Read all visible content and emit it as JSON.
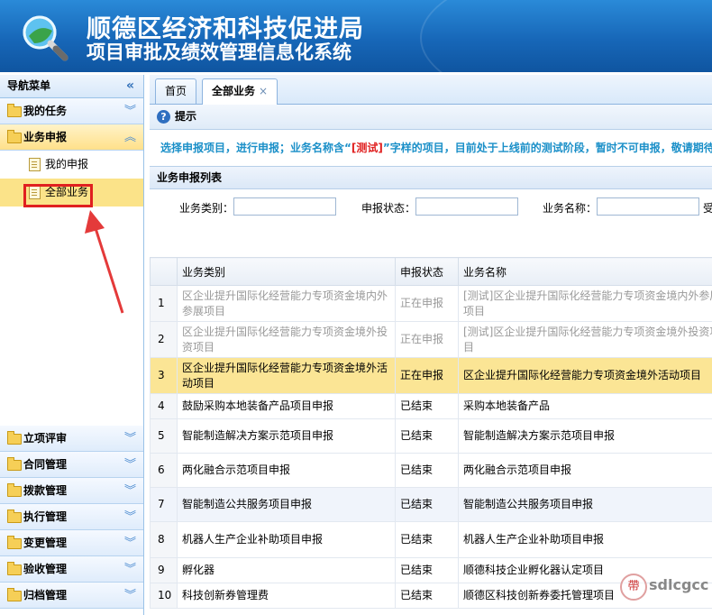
{
  "header": {
    "title_line1": "顺德区经济和科技促进局",
    "title_line2": "项目审批及绩效管理信息化系统"
  },
  "sidebar": {
    "title": "导航菜单",
    "collapse_icon": "double-chevron-left",
    "menus_top": [
      {
        "label": "我的任务",
        "expanded": false
      },
      {
        "label": "业务申报",
        "expanded": true
      }
    ],
    "sub_items": [
      {
        "label": "我的申报",
        "selected": false
      },
      {
        "label": "全部业务",
        "selected": true
      }
    ],
    "menus_bottom": [
      {
        "label": "立项评审"
      },
      {
        "label": "合同管理"
      },
      {
        "label": "拨款管理"
      },
      {
        "label": "执行管理"
      },
      {
        "label": "变更管理"
      },
      {
        "label": "验收管理"
      },
      {
        "label": "归档管理"
      }
    ],
    "annotation_color": "#e02020"
  },
  "tabs": [
    {
      "label": "首页",
      "active": false
    },
    {
      "label": "全部业务",
      "active": true,
      "close": "×"
    }
  ],
  "tip": {
    "title": "提示",
    "text_before": "选择申报项目，进行申报；业务名称含“",
    "text_red": "[测试]",
    "text_after": "”字样的项目，目前处于上线前的测试阶段，暂时不可申报，敬请期待"
  },
  "list": {
    "title": "业务申报列表",
    "filters": [
      {
        "label": "业务类别：",
        "value": ""
      },
      {
        "label": "申报状态：",
        "value": ""
      },
      {
        "label": "业务名称：",
        "value": ""
      }
    ],
    "filter_overflow": "受",
    "columns": [
      "",
      "业务类别",
      "申报状态",
      "业务名称"
    ],
    "rows": [
      {
        "no": "1",
        "category": "区企业提升国际化经营能力专项资金境内外参展项目",
        "status": "正在申报",
        "name": "[测试]区企业提升国际化经营能力专项资金境内外参展项目",
        "style": "gray"
      },
      {
        "no": "2",
        "category": "区企业提升国际化经营能力专项资金境外投资项目",
        "status": "正在申报",
        "name": "[测试]区企业提升国际化经营能力专项资金境外投资项目",
        "style": "gray"
      },
      {
        "no": "3",
        "category": "区企业提升国际化经营能力专项资金境外活动项目",
        "status": "正在申报",
        "name": "区企业提升国际化经营能力专项资金境外活动项目",
        "style": "hl"
      },
      {
        "no": "4",
        "category": "鼓励采购本地装备产品项目申报",
        "status": "已结束",
        "name": "采购本地装备产品",
        "style": ""
      },
      {
        "no": "5",
        "category": "智能制造解决方案示范项目申报",
        "status": "已结束",
        "name": "智能制造解决方案示范项目申报",
        "style": ""
      },
      {
        "no": "6",
        "category": "两化融合示范项目申报",
        "status": "已结束",
        "name": "两化融合示范项目申报",
        "style": ""
      },
      {
        "no": "7",
        "category": "智能制造公共服务项目申报",
        "status": "已结束",
        "name": "智能制造公共服务项目申报",
        "style": "alt"
      },
      {
        "no": "8",
        "category": "机器人生产企业补助项目申报",
        "status": "已结束",
        "name": "机器人生产企业补助项目申报",
        "style": ""
      },
      {
        "no": "9",
        "category": "孵化器",
        "status": "已结束",
        "name": "顺德科技企业孵化器认定项目",
        "style": ""
      },
      {
        "no": "10",
        "category": "科技创新券管理费",
        "status": "已结束",
        "name": "顺德区科技创新券委托管理项目",
        "style": ""
      }
    ]
  },
  "watermark": {
    "seal": "帶",
    "text": "sdlcgcc"
  }
}
